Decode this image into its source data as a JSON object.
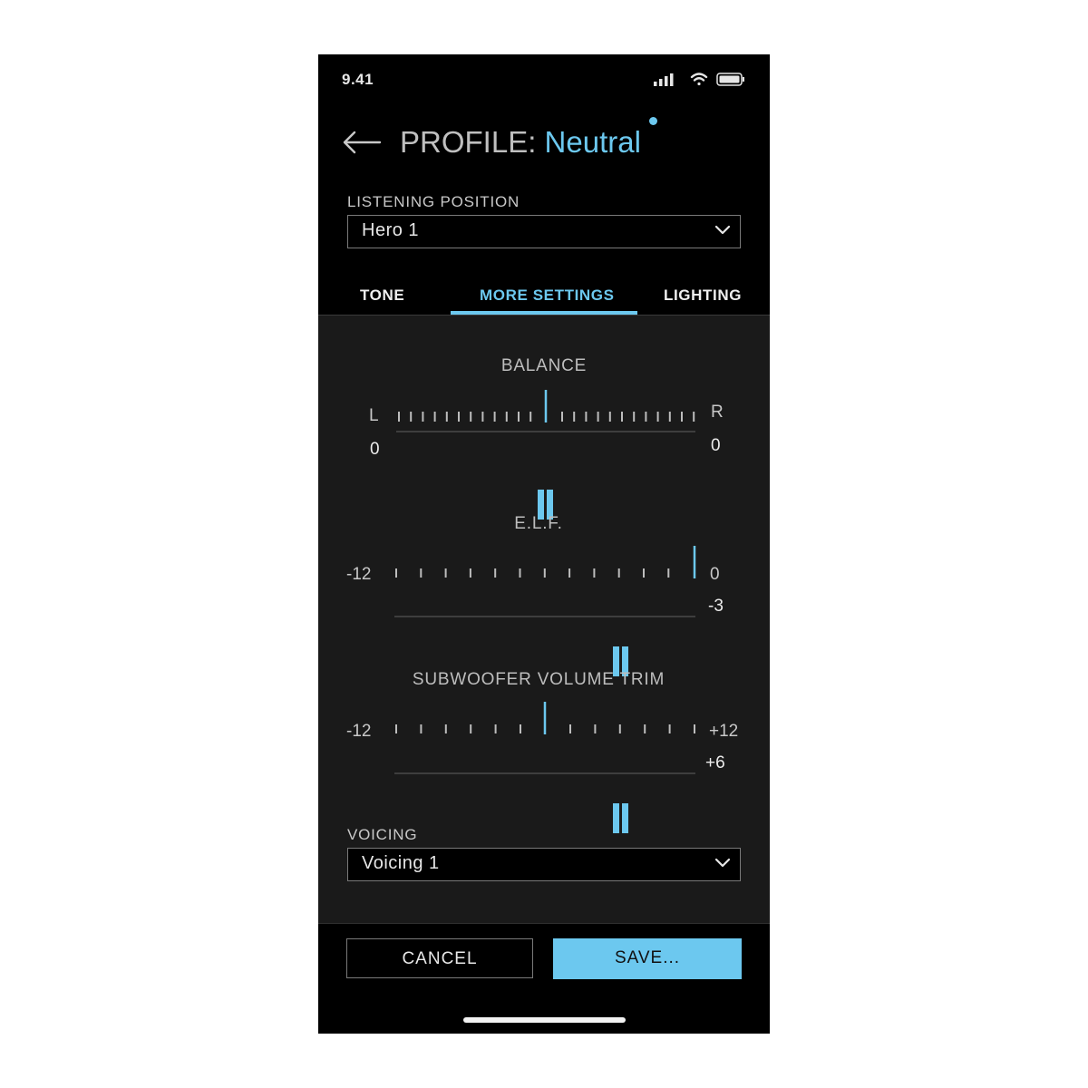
{
  "status_bar": {
    "time": "9.41",
    "icons": [
      "signal-icon",
      "wifi-icon",
      "battery-icon"
    ]
  },
  "header": {
    "title_prefix": "PROFILE:",
    "profile_name": "Neutral",
    "modified_indicator": true
  },
  "listening_position": {
    "label": "LISTENING POSITION",
    "value": "Hero 1"
  },
  "tabs": [
    {
      "label": "TONE",
      "active": false
    },
    {
      "label": "MORE SETTINGS",
      "active": true
    },
    {
      "label": "LIGHTING",
      "active": false
    }
  ],
  "balance": {
    "title": "BALANCE",
    "left_label": "L",
    "right_label": "R",
    "left_value": "0",
    "right_value": "0",
    "level": 0.5
  },
  "elf": {
    "title": "E.L.F.",
    "min_label": "-12",
    "max_label": "0",
    "value": "-3",
    "level": 0.75
  },
  "subwoofer": {
    "title": "SUBWOOFER VOLUME TRIM",
    "min_label": "-12",
    "max_label": "+12",
    "value": "+6",
    "level": 0.75
  },
  "voicing": {
    "label": "VOICING",
    "value": "Voicing 1"
  },
  "buttons": {
    "cancel": "CANCEL",
    "save": "SAVE..."
  },
  "colors": {
    "accent": "#6cc8ef",
    "background": "#000000",
    "panel": "#1a1a1a"
  }
}
